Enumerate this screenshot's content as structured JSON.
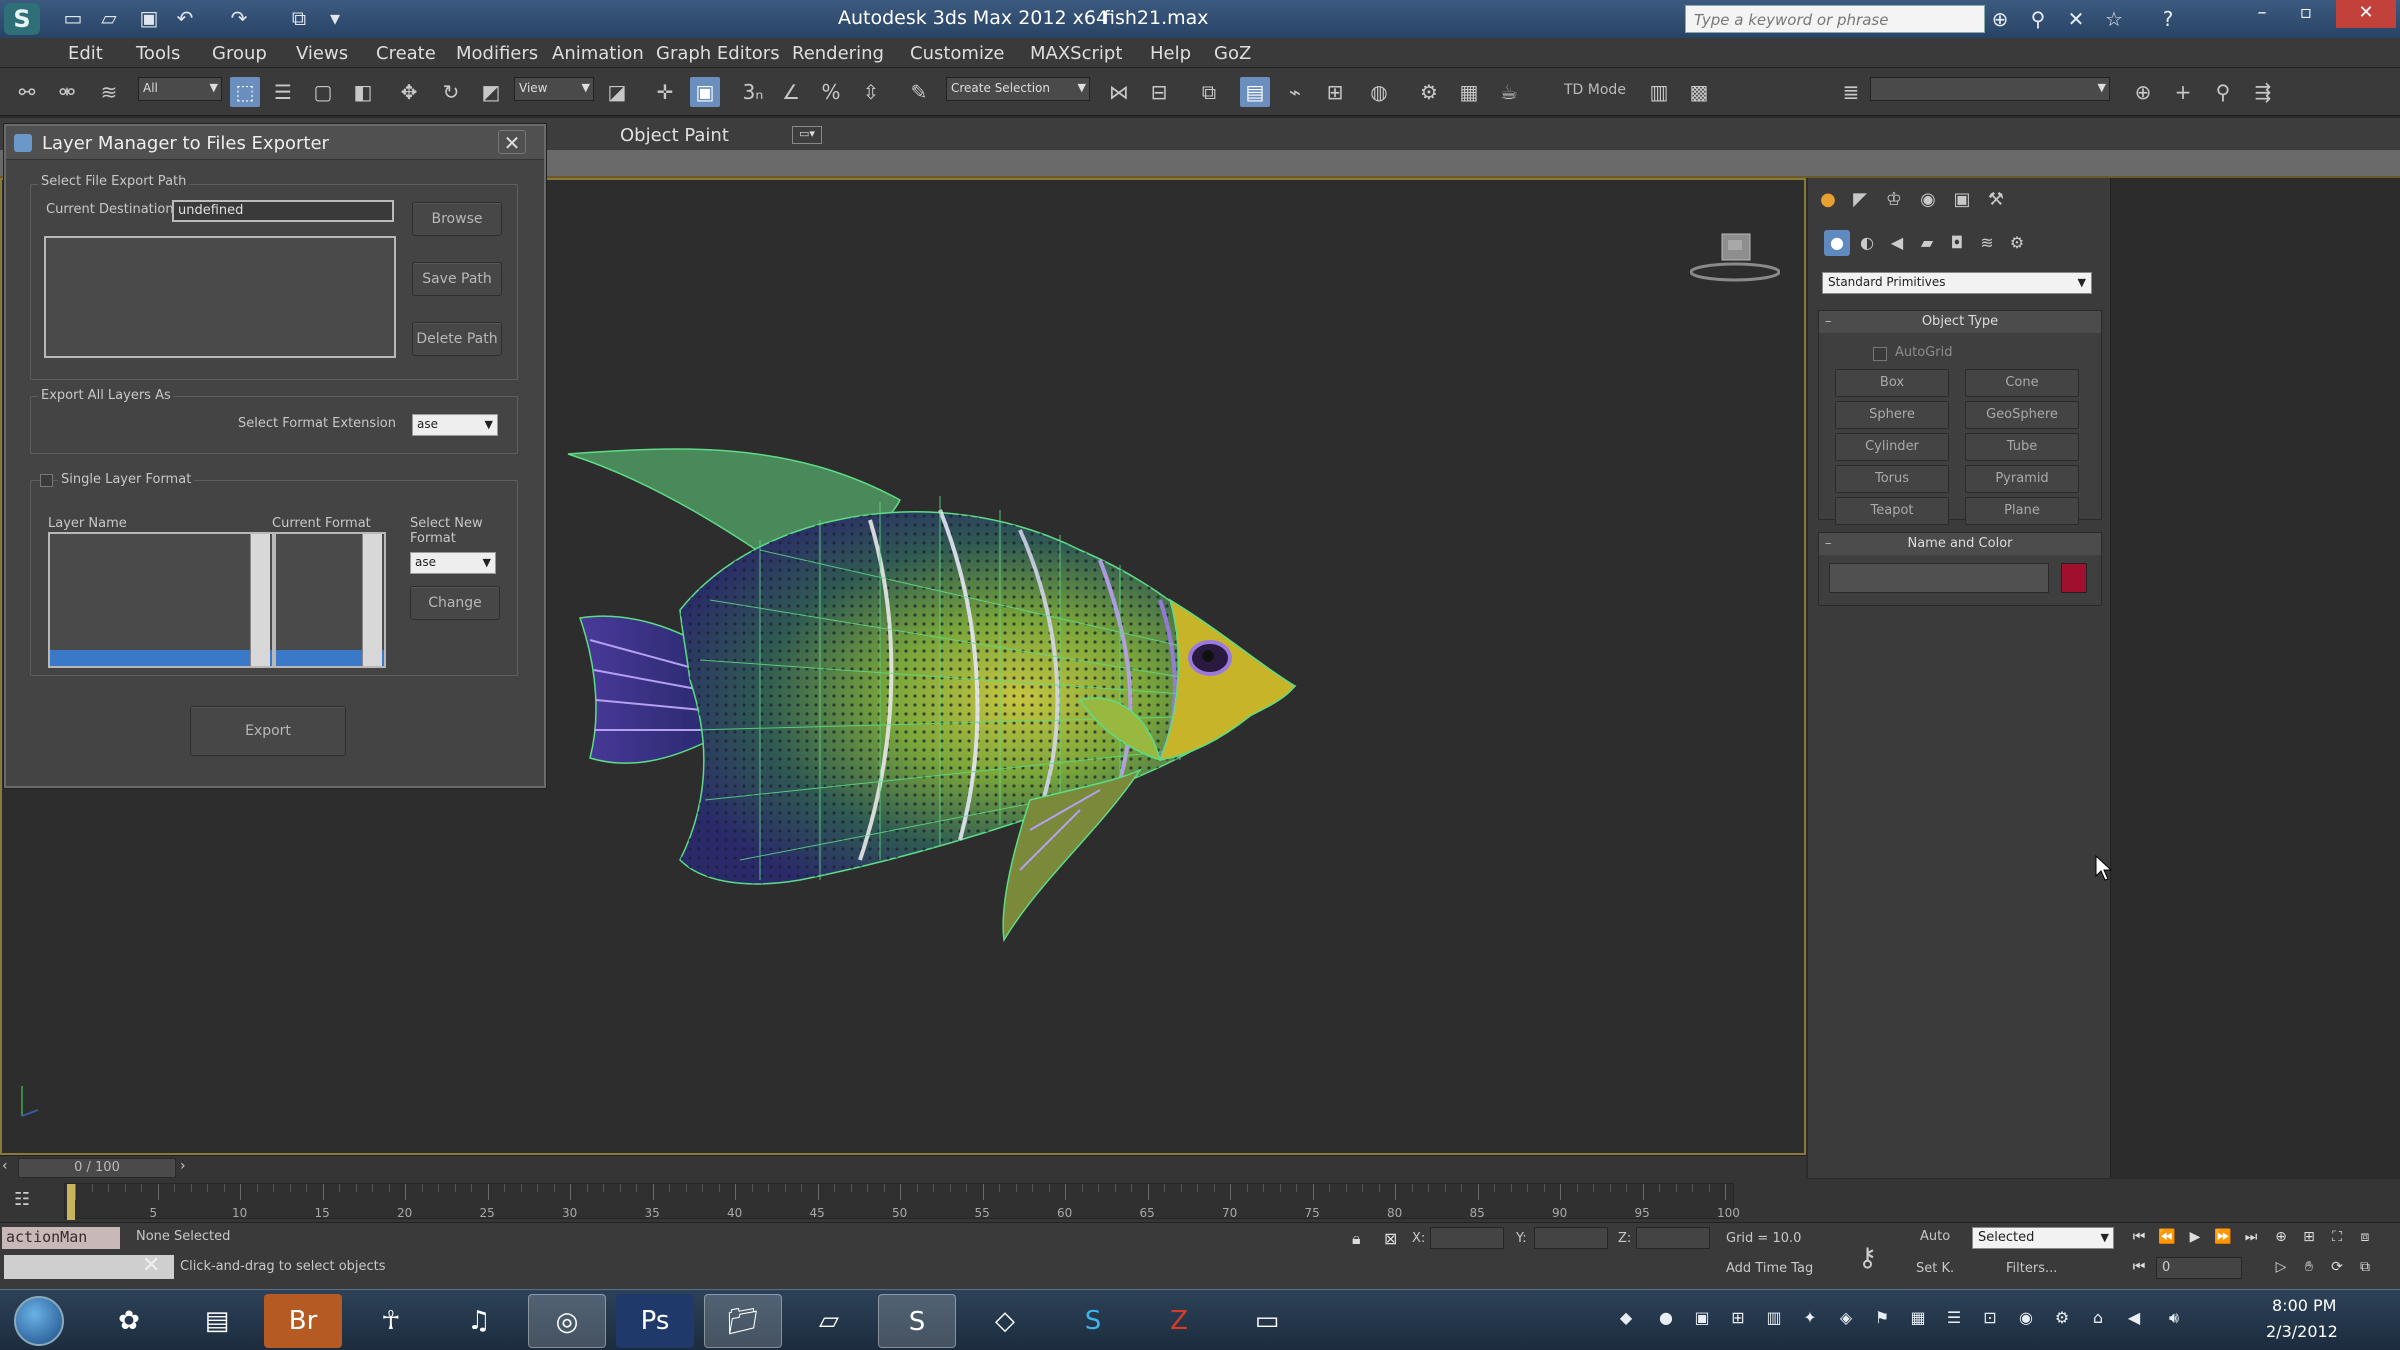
{
  "app": {
    "title": "Autodesk 3ds Max  2012 x64",
    "file": "fish21.max",
    "search_placeholder": "Type a keyword or phrase"
  },
  "menu": [
    "Edit",
    "Tools",
    "Group",
    "Views",
    "Create",
    "Modifiers",
    "Animation",
    "Graph Editors",
    "Rendering",
    "Customize",
    "MAXScript",
    "Help",
    "GoZ"
  ],
  "toolbar": {
    "selection_filter": "All",
    "reference_coord": "View",
    "named_selection": "Create Selection",
    "td_mode": "TD Mode"
  },
  "ribbon": {
    "object_paint": "Object Paint"
  },
  "dialog": {
    "title": "Layer Manager to Files Exporter",
    "path_group": "Select File Export Path",
    "current_destination_label": "Current Destination",
    "current_destination_value": "undefined",
    "browse": "Browse",
    "save_path": "Save Path",
    "delete_path": "Delete Path",
    "export_all_group": "Export All Layers As",
    "select_format_ext_label": "Select Format Extension",
    "format_value": "ase",
    "single_layer_label": "Single Layer Format",
    "layer_name_header": "Layer Name",
    "current_format_header": "Current Format",
    "select_new_format_label": "Select New Format",
    "new_format_value": "ase",
    "change": "Change",
    "export": "Export"
  },
  "command_panel": {
    "category": "Standard Primitives",
    "object_type_title": "Object Type",
    "autogrid": "AutoGrid",
    "primitives": [
      "Box",
      "Cone",
      "Sphere",
      "GeoSphere",
      "Cylinder",
      "Tube",
      "Torus",
      "Pyramid",
      "Teapot",
      "Plane"
    ],
    "name_color_title": "Name and Color",
    "object_color": "#a0102e"
  },
  "timeline": {
    "slider_text": "0 / 100",
    "ticks": [
      "5",
      "10",
      "15",
      "20",
      "25",
      "30",
      "35",
      "40",
      "45",
      "50",
      "55",
      "60",
      "65",
      "70",
      "75",
      "80",
      "85",
      "90",
      "95",
      "100"
    ]
  },
  "status": {
    "maxscript": "actionMan",
    "selection": "None Selected",
    "prompt": "Click-and-drag to select objects",
    "x_label": "X:",
    "y_label": "Y:",
    "z_label": "Z:",
    "grid": "Grid = 10.0",
    "add_time_tag": "Add Time Tag",
    "auto": "Auto",
    "set_key": "Set K.",
    "selected": "Selected",
    "filters": "Filters...",
    "frame": "0"
  },
  "taskbar": {
    "time": "8:00 PM",
    "date": "2/3/2012",
    "apps": [
      "explorer-icon",
      "media-icon",
      "bridge-icon",
      "zbrush-icon",
      "itunes-icon",
      "chrome-icon",
      "photoshop-icon",
      "folder-icon",
      "notepad-icon",
      "3dsmax-icon",
      "unity-icon",
      "skype-icon",
      "filezilla-icon",
      "monitor-icon"
    ]
  }
}
